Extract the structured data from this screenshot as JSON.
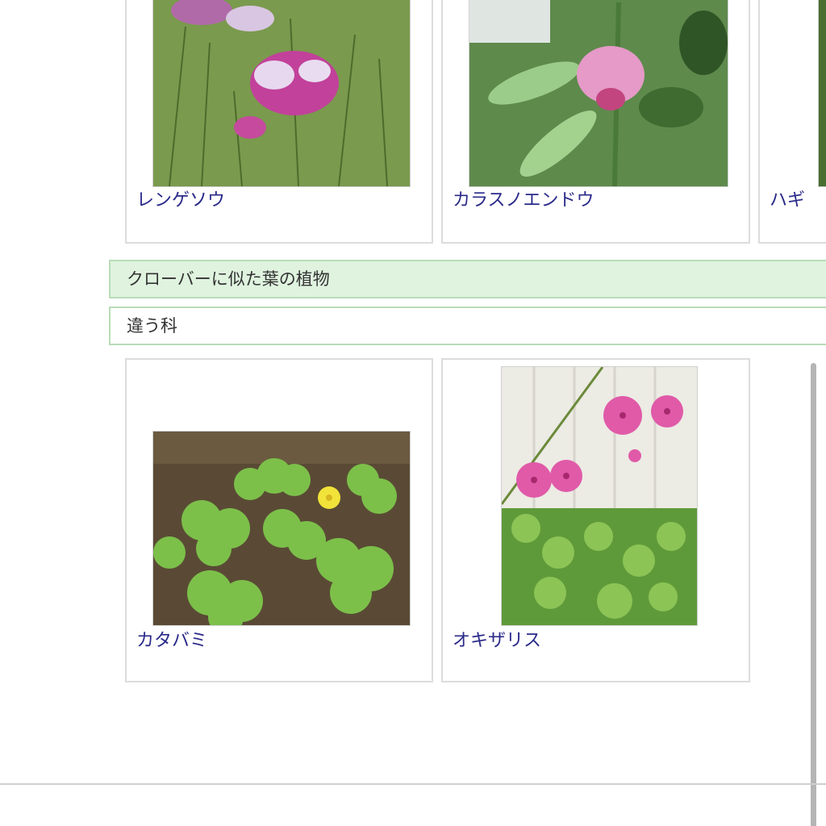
{
  "top_cards": [
    {
      "name": "レンゲソウ"
    },
    {
      "name": "カラスノエンドウ"
    },
    {
      "name": "ハギ"
    }
  ],
  "section": {
    "title": "クローバーに似た葉の植物",
    "subtitle": "違う科"
  },
  "bottom_cards": [
    {
      "name": "カタバミ"
    },
    {
      "name": "オキザリス"
    }
  ],
  "colors": {
    "link": "#2a2a8a",
    "section_bg": "#dff3df",
    "section_border": "#b8dcb8"
  }
}
